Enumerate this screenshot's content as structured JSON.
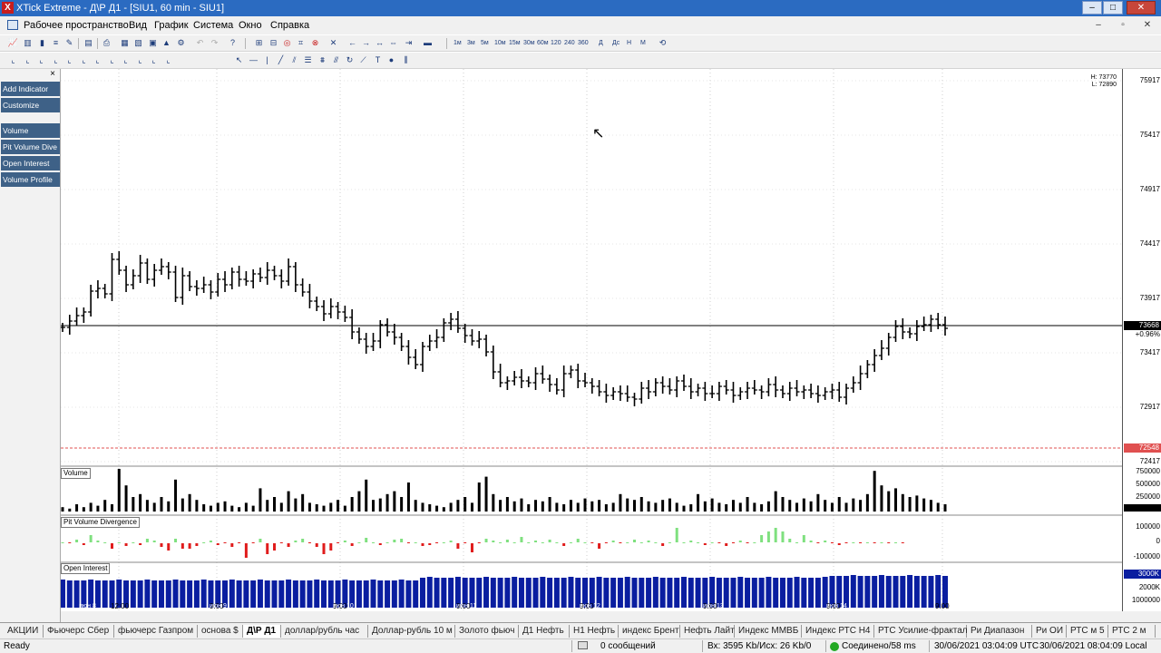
{
  "window": {
    "title": "XTick Extreme - Д\\Р Д1 - [SIU1, 60 min - SIU1]",
    "app_icon": "X"
  },
  "window_controls": {
    "minimize": "–",
    "maximize": "□",
    "close": "✕"
  },
  "mdi_controls": {
    "minimize": "–",
    "restore": "▫",
    "close": "✕"
  },
  "menu": [
    "Рабочее пространство",
    "Вид",
    "График",
    "Система",
    "Окно",
    "Справка"
  ],
  "timeframes": [
    "1м",
    "3м",
    "5м",
    "10м",
    "15м",
    "30м",
    "60м",
    "120",
    "240",
    "360"
  ],
  "periods": [
    "Д",
    "Дс",
    "Н",
    "М"
  ],
  "left_panel": {
    "close": "×",
    "buttons": [
      "Add Indicator",
      "Customize"
    ],
    "indicators": [
      "Volume",
      "Pit Volume Dive",
      "Open Interest",
      "Volume Profile"
    ]
  },
  "chart": {
    "hl_high": "H: 73770",
    "hl_low": "L: 72890",
    "y_labels": [
      "75917",
      "75417",
      "74917",
      "74417",
      "73917",
      "73417",
      "72917",
      "72417"
    ],
    "last_price": "73668",
    "change_pct": "+0.96%",
    "stop_price": "72548",
    "x_labels": [
      "12:00",
      "9:00",
      "9:00",
      "9:00",
      "9:00",
      "9:00",
      "9:00",
      "9:00"
    ],
    "date_labels": [
      "июн 8",
      "июн 9",
      "июн 10",
      "июн 11",
      "июн 12",
      "июн 13",
      "июн 14"
    ],
    "volume": {
      "label": "Volume",
      "ticks": [
        "750000",
        "500000",
        "250000"
      ]
    },
    "pvd": {
      "label": "Pit Volume Divergence",
      "ticks": [
        "100000",
        "0",
        "-100000"
      ]
    },
    "oi": {
      "label": "Open Interest",
      "ticks": [
        "3000K",
        "2000K",
        "1000000"
      ],
      "tag": "3000K"
    },
    "colors": {
      "up": "#7fe07f",
      "down": "#e01c1c",
      "oi": "#0a1ea0",
      "stop": "#e05050"
    }
  },
  "tabs": [
    "АКЦИИ",
    "Фьючерс Сбер",
    "фьючерс Газпром",
    "основа $",
    "Д\\Р Д1",
    "доллар/рубль час",
    "Доллар-рубль 10 м",
    "Золото фьюч",
    "Д1 Нефть",
    "Н1 Нефть",
    "индекс Брент",
    "Нефть Лайт",
    "Индекс ММВБ",
    "Индекс РТС Н4",
    "РТС Усилие-фрактал",
    "Ри Диапазон",
    "Ри ОИ",
    "РТС м 5",
    "РТС 2 м"
  ],
  "active_tab": 4,
  "status": {
    "ready": "Ready",
    "messages": "0 сообщений",
    "traffic": "Вх: 3595 Kb/Исх: 26 Kb/0",
    "connection": "Соединено/58 ms",
    "utc": "30/06/2021 03:04:09 UTC",
    "local": "30/06/2021 08:04:09 Local"
  }
}
